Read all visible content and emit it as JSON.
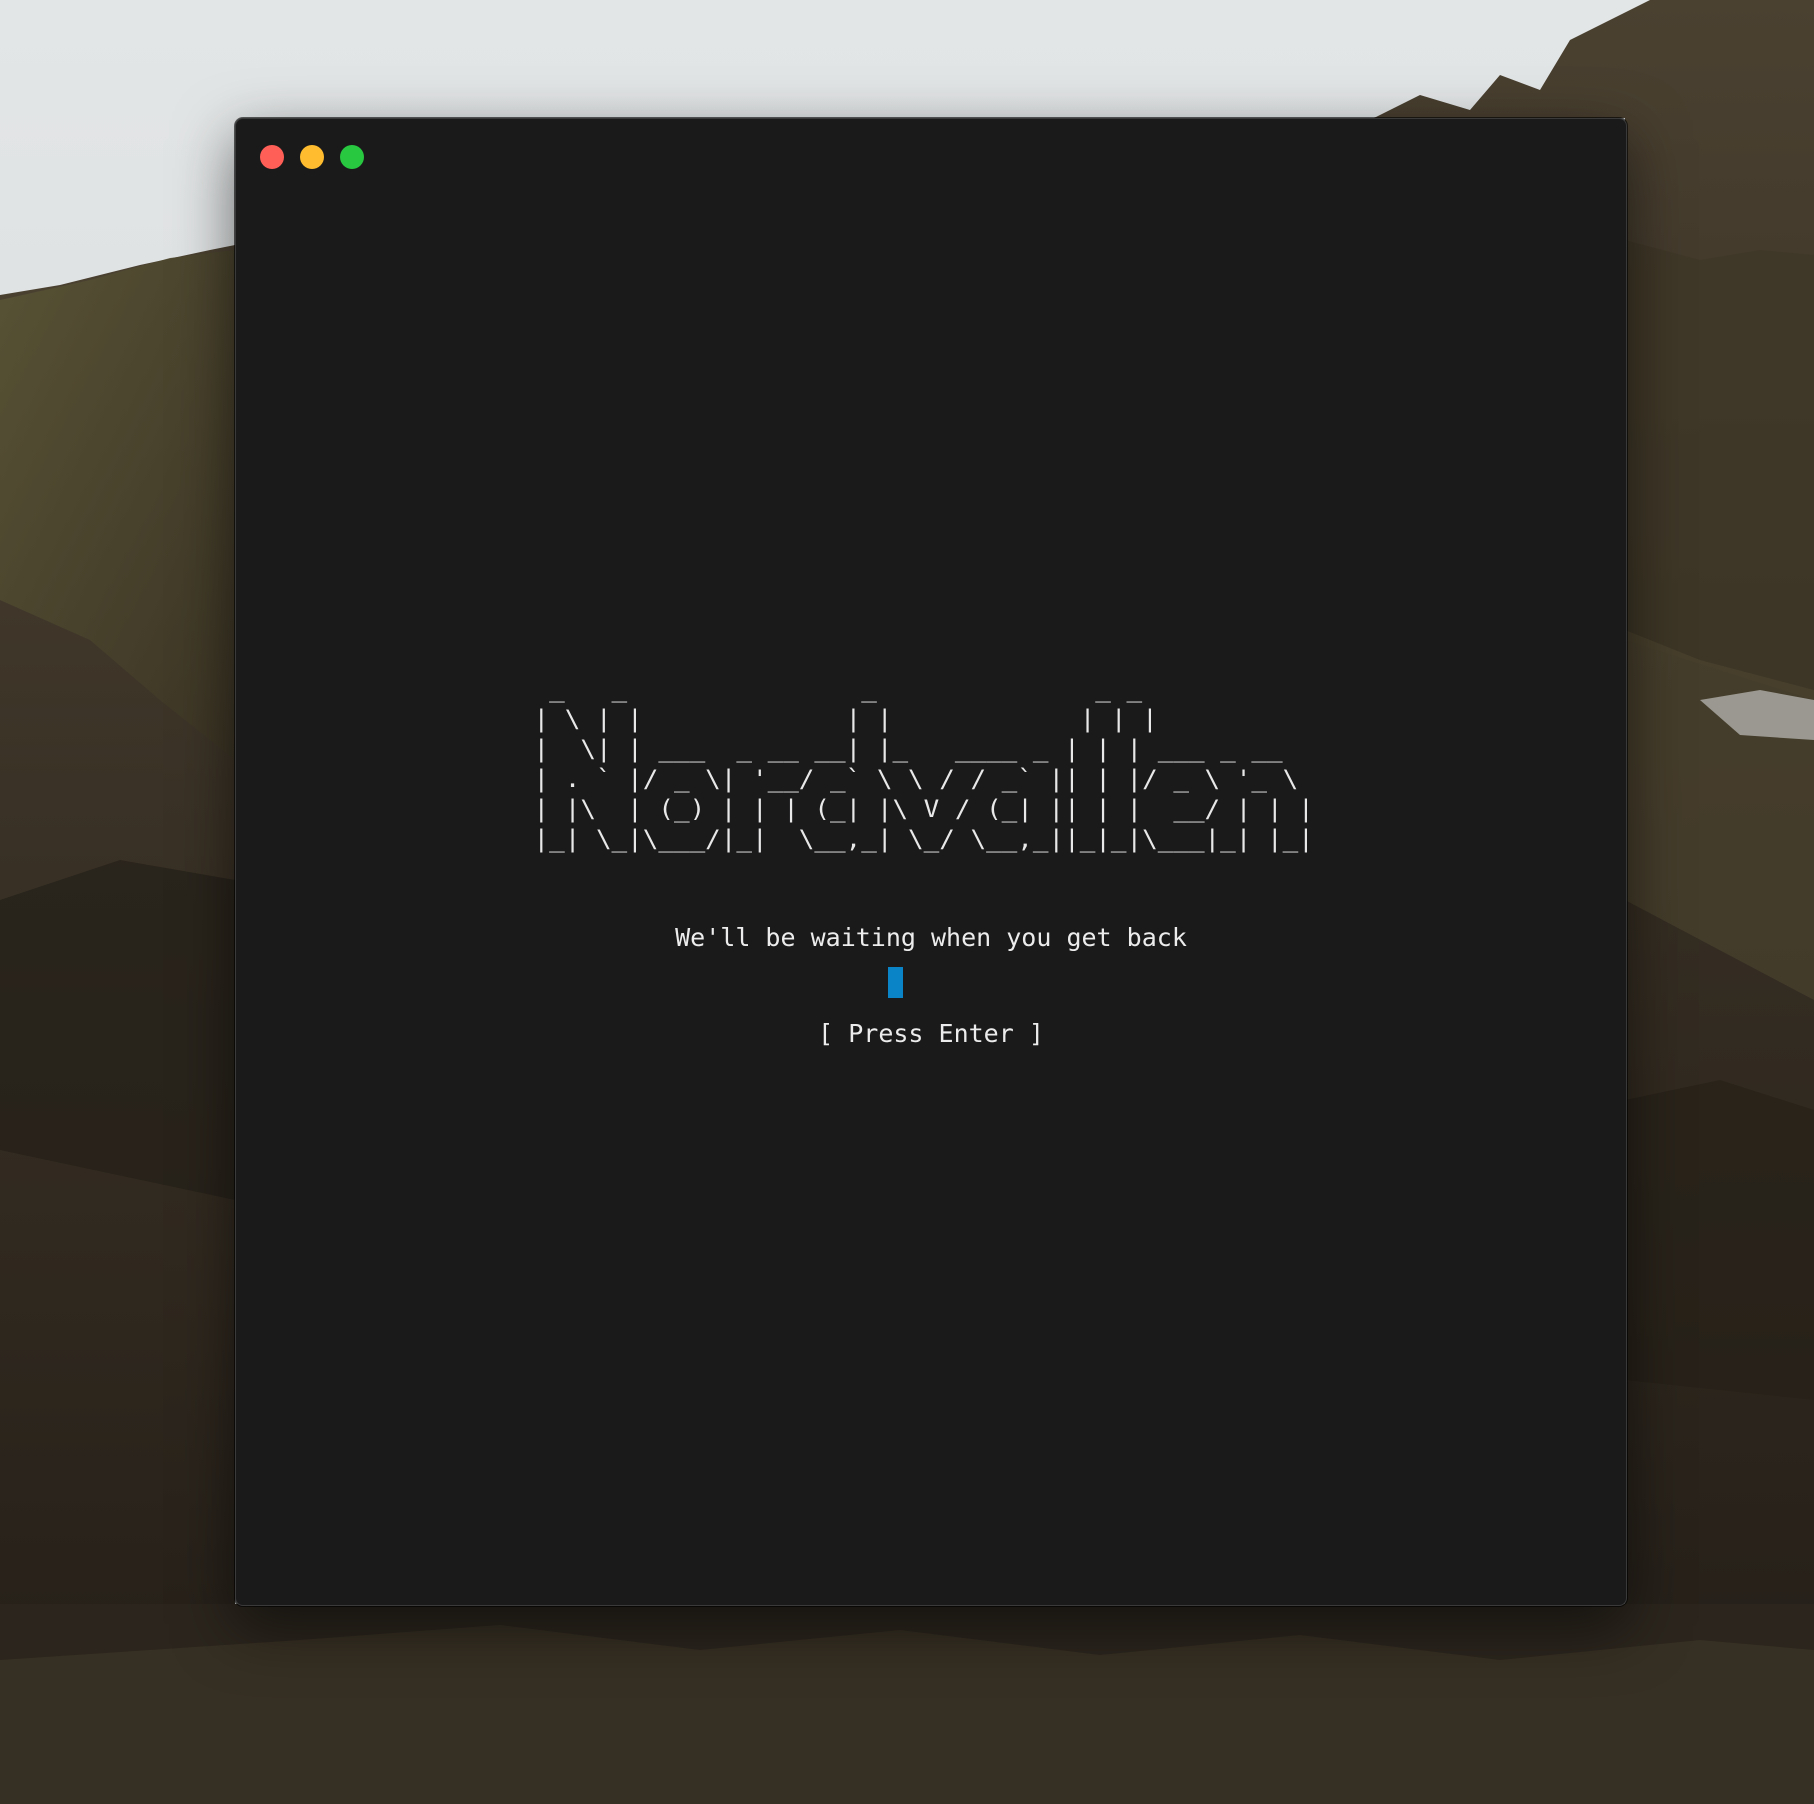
{
  "window": {
    "controls": {
      "close": "close",
      "minimize": "minimize",
      "zoom": "zoom"
    },
    "colors": {
      "background": "#1a1a1b",
      "text": "#ececec",
      "cursor": "#0a84c6",
      "close": "#ff5f57",
      "minimize": "#febc2e",
      "zoom": "#28c840"
    }
  },
  "screen": {
    "ascii_title": " _   _               _              _ _            \n| \\ | |             | |            | | |           \n|  \\| | ___  _ __ __| |_   ____ _ | | | ___ _ __  \n| . ` |/ _ \\| '__/ _` \\ \\ / / _` || | |/ _ \\ '_ \\ \n| |\\  | (_) | | | (_| |\\ V / (_| || | |  __/ | | |\n|_| \\_|\\___/|_|  \\__,_| \\_/ \\__,_||_|_|\\___|_| |_|",
    "tagline": "We'll be waiting when you get back",
    "prompt": "[ Press Enter ]"
  }
}
